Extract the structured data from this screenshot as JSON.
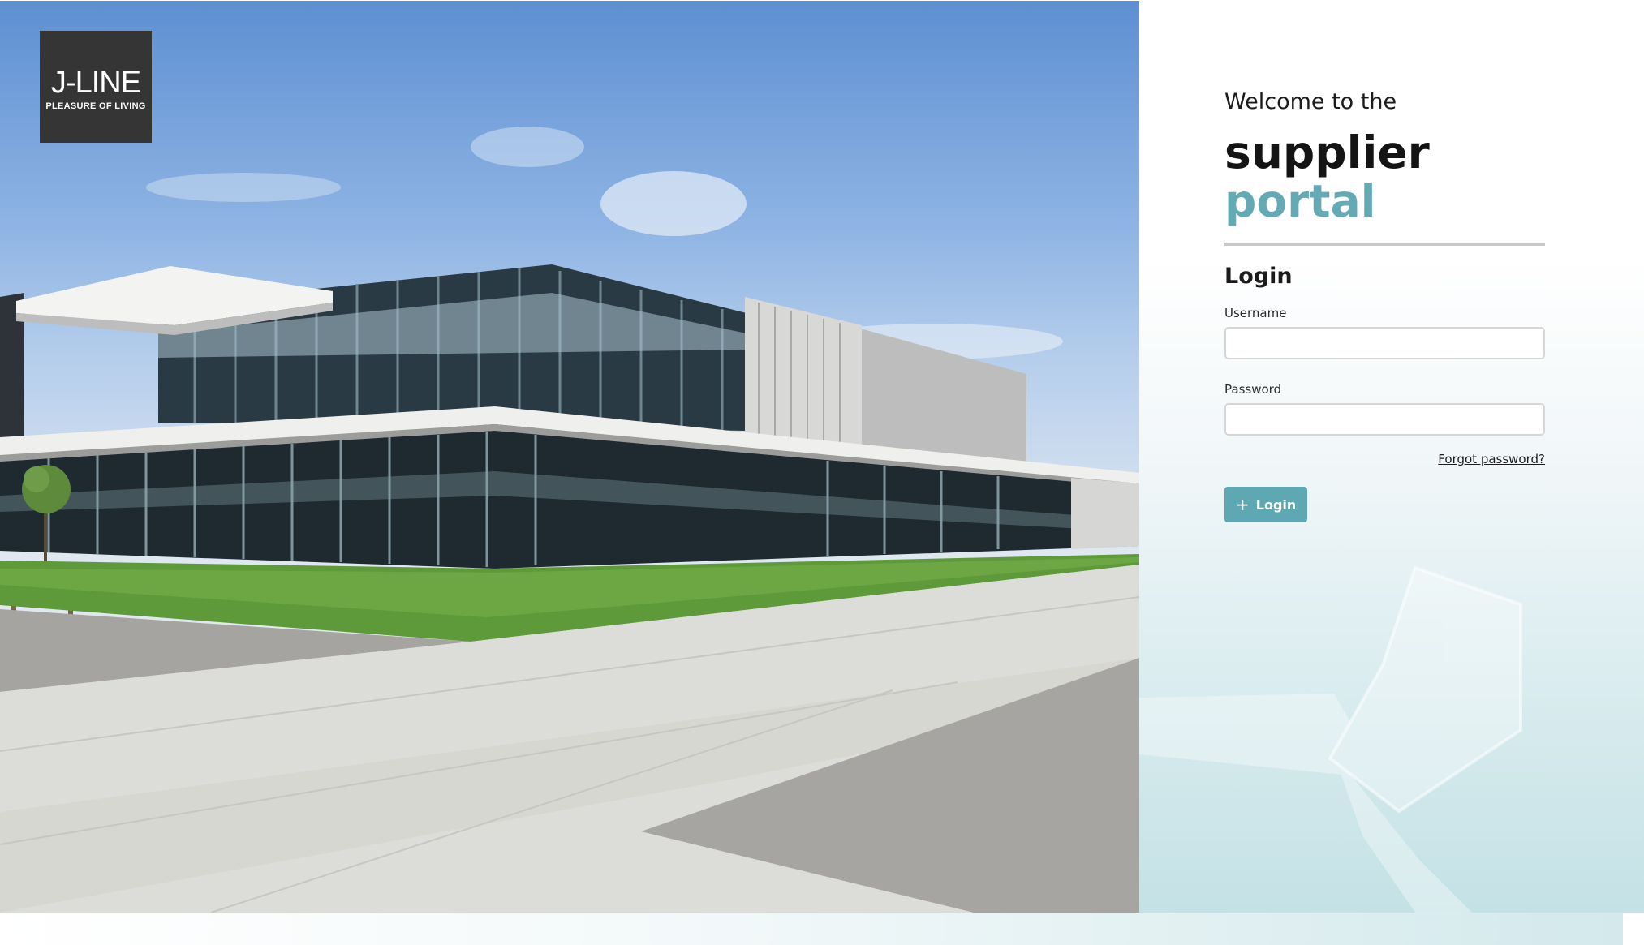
{
  "brand": {
    "logo_word": "J-LINE",
    "logo_tagline": "PLEASURE OF LIVING",
    "accent_color": "#64aab5",
    "logo_bg": "#363535"
  },
  "hero": {
    "image": "modern office building with glass facade, lawn and concrete plaza"
  },
  "login": {
    "welcome": "Welcome to the",
    "headline_line1": "supplier",
    "headline_line2": "portal",
    "title": "Login",
    "username_label": "Username",
    "username_value": "",
    "password_label": "Password",
    "password_value": "",
    "forgot_label": "Forgot password?",
    "button_label": "Login",
    "button_icon": "plus-icon"
  }
}
